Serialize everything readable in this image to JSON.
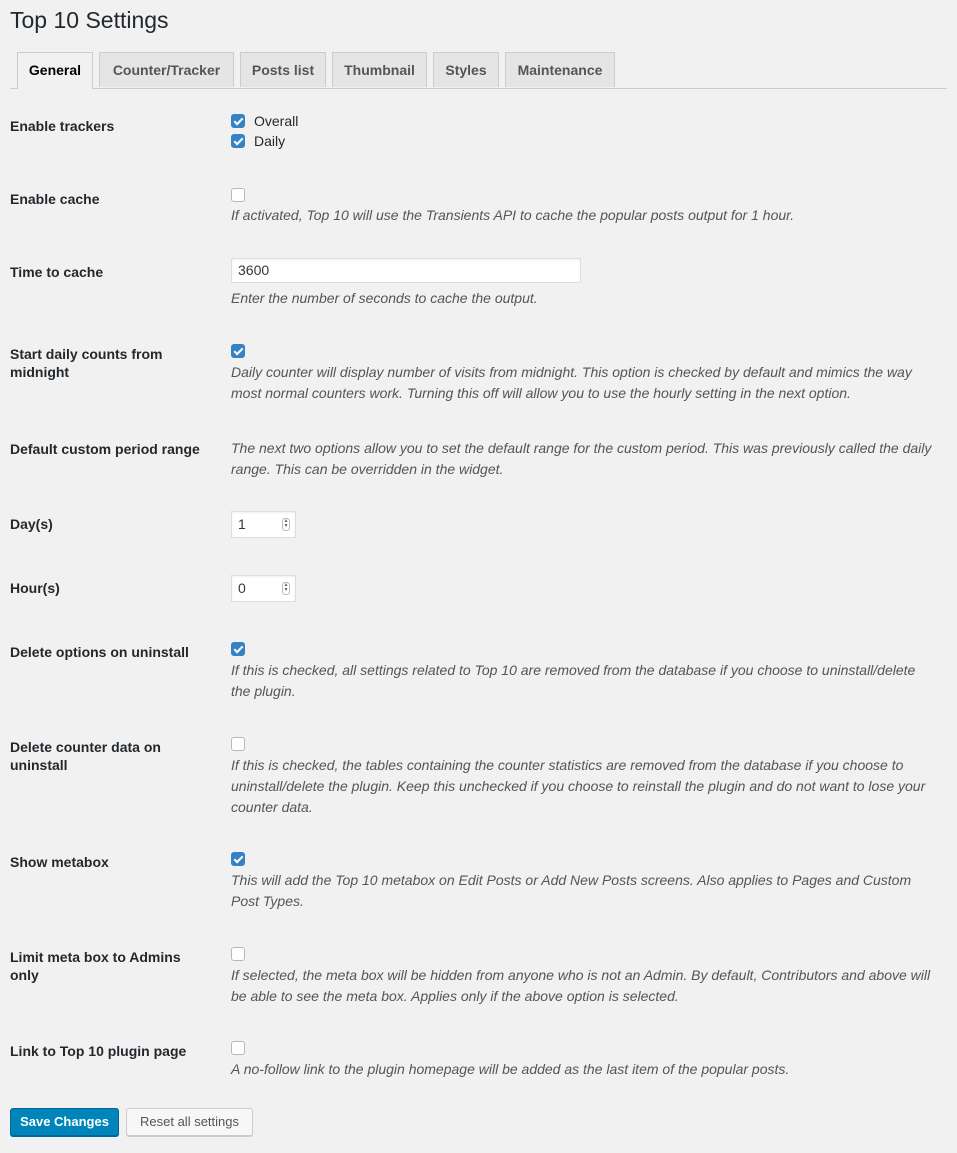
{
  "page": {
    "title": "Top 10 Settings"
  },
  "tabs": [
    {
      "label": "General",
      "active": true
    },
    {
      "label": "Counter/Tracker",
      "active": false
    },
    {
      "label": "Posts list",
      "active": false
    },
    {
      "label": "Thumbnail",
      "active": false
    },
    {
      "label": "Styles",
      "active": false
    },
    {
      "label": "Maintenance",
      "active": false
    }
  ],
  "settings": {
    "enable_trackers": {
      "label": "Enable trackers",
      "overall": {
        "label": "Overall",
        "checked": true
      },
      "daily": {
        "label": "Daily",
        "checked": true
      }
    },
    "enable_cache": {
      "label": "Enable cache",
      "checked": false,
      "desc": "If activated, Top 10 will use the Transients API to cache the popular posts output for 1 hour."
    },
    "time_to_cache": {
      "label": "Time to cache",
      "value": "3600",
      "desc": "Enter the number of seconds to cache the output."
    },
    "daily_midnight": {
      "label": "Start daily counts from midnight",
      "checked": true,
      "desc": "Daily counter will display number of visits from midnight. This option is checked by default and mimics the way most normal counters work. Turning this off will allow you to use the hourly setting in the next option."
    },
    "custom_range": {
      "label": "Default custom period range",
      "desc": "The next two options allow you to set the default range for the custom period. This was previously called the daily range. This can be overridden in the widget."
    },
    "days": {
      "label": "Day(s)",
      "value": "1"
    },
    "hours": {
      "label": "Hour(s)",
      "value": "0"
    },
    "delete_options": {
      "label": "Delete options on uninstall",
      "checked": true,
      "desc": "If this is checked, all settings related to Top 10 are removed from the database if you choose to uninstall/delete the plugin."
    },
    "delete_data": {
      "label": "Delete counter data on uninstall",
      "checked": false,
      "desc": "If this is checked, the tables containing the counter statistics are removed from the database if you choose to uninstall/delete the plugin. Keep this unchecked if you choose to reinstall the plugin and do not want to lose your counter data."
    },
    "show_metabox": {
      "label": "Show metabox",
      "checked": true,
      "desc": "This will add the Top 10 metabox on Edit Posts or Add New Posts screens. Also applies to Pages and Custom Post Types."
    },
    "metabox_admins": {
      "label": "Limit meta box to Admins only",
      "checked": false,
      "desc": "If selected, the meta box will be hidden from anyone who is not an Admin. By default, Contributors and above will be able to see the meta box. Applies only if the above option is selected."
    },
    "show_credit": {
      "label": "Link to Top 10 plugin page",
      "checked": false,
      "desc": "A no-follow link to the plugin homepage will be added as the last item of the popular posts."
    }
  },
  "buttons": {
    "save": "Save Changes",
    "reset": "Reset all settings"
  },
  "colors": {
    "primary": "#0085ba",
    "checkbox": "#3582c4",
    "background": "#f1f1f1"
  }
}
